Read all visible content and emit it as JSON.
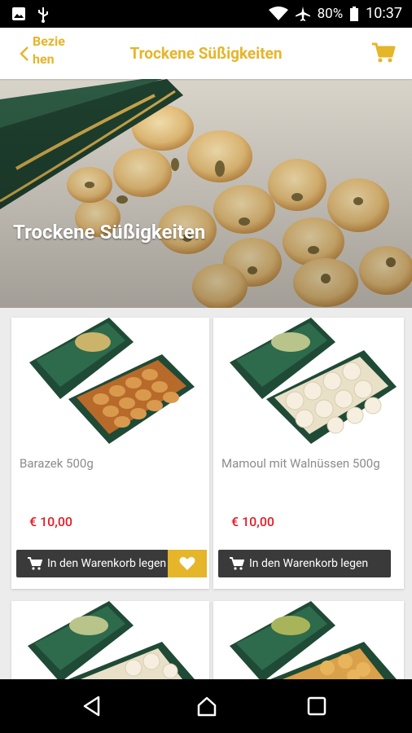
{
  "status": {
    "battery": "80%",
    "time": "10:37"
  },
  "header": {
    "back_label": "Bezie hen",
    "title": "Trockene Süßigkeiten"
  },
  "hero": {
    "title": "Trockene Süßigkeiten"
  },
  "products": [
    {
      "name": "Barazek 500g",
      "price": "€  10,00",
      "button": "In den Warenkorb legen"
    },
    {
      "name": "Mamoul mit Walnüssen 500g",
      "price": "€  10,00",
      "button": "In den Warenkorb legen"
    }
  ],
  "colors": {
    "accent": "#e5b52a",
    "price": "#e21e28",
    "button": "#3a3a3a"
  }
}
